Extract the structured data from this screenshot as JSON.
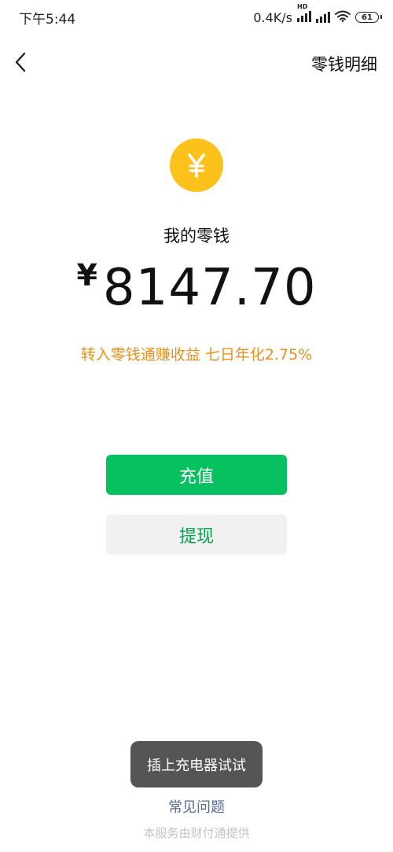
{
  "status_bar": {
    "time": "下午5:44",
    "network_speed": "0.4K/s",
    "hd_label": "HD",
    "battery": "61",
    "icons": [
      "signal-hd-icon",
      "signal-icon",
      "wifi-icon",
      "battery-icon"
    ]
  },
  "nav": {
    "back_icon": "chevron-left-icon",
    "title": "零钱明细"
  },
  "balance": {
    "coin_icon": "yen-coin-icon",
    "coin_color": "#fcc21b",
    "label": "我的零钱",
    "currency": "¥",
    "amount": "8147.70"
  },
  "promo": {
    "text": "转入零钱通赚收益 七日年化2.75%",
    "color": "#e7901a"
  },
  "actions": {
    "topup_label": "充值",
    "topup_color": "#07c160",
    "withdraw_label": "提现",
    "withdraw_text_color": "#07a153"
  },
  "toast": {
    "text": "插上充电器试试"
  },
  "footer": {
    "faq_label": "常见问题",
    "provider_text": "本服务由财付通提供"
  }
}
